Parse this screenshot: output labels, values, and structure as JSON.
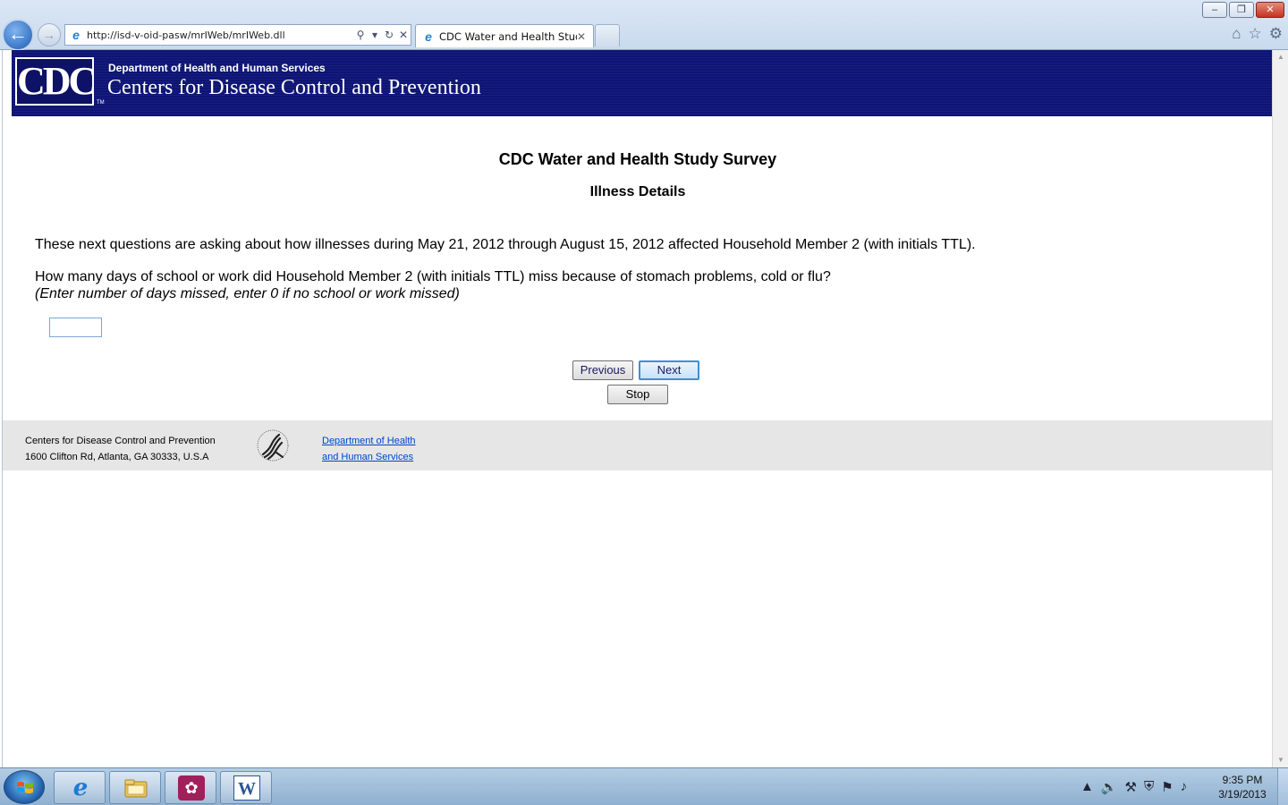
{
  "browser": {
    "address_url": "http://isd-v-oid-pasw/mrIWeb/mrIWeb.dll",
    "tab_title": "CDC Water and Health Study",
    "window_controls": {
      "minimize": "–",
      "restore": "❐",
      "close": "✕"
    },
    "icons": [
      "back-arrow-icon",
      "forward-arrow-icon",
      "search-icon",
      "refresh-icon",
      "stop-icon",
      "home-icon",
      "favorites-star-icon",
      "settings-gear-icon"
    ]
  },
  "banner": {
    "logo_text": "CDC",
    "department": "Department of Health and Human Services",
    "agency": "Centers for Disease Control and Prevention"
  },
  "survey": {
    "title": "CDC Water and Health Study Survey",
    "section": "Illness Details",
    "intro": "These next questions are asking about how illnesses during May 21, 2012 through August 15, 2012 affected Household Member 2 (with initials TTL).",
    "question": "How many days of school or work did Household Member 2 (with initials TTL) miss because of stomach problems, cold or flu?",
    "instruction": "(Enter number of days missed, enter 0 if no school or work missed)",
    "days_missed_value": "",
    "buttons": {
      "previous": "Previous",
      "next": "Next",
      "stop": "Stop"
    }
  },
  "footer": {
    "org_line1": "Centers for Disease Control and Prevention",
    "org_line2": "1600 Clifton Rd, Atlanta, GA 30333, U.S.A",
    "hhs_link_line1": "Department of Health",
    "hhs_link_line2": "and Human Services"
  },
  "taskbar": {
    "apps": [
      "internet-explorer-icon",
      "file-explorer-icon",
      "app-icon",
      "word-icon"
    ],
    "clock_time": "9:35 PM",
    "clock_date": "3/19/2013"
  },
  "colors": {
    "banner_blue": "#0f1570",
    "footer_gray": "#e6e6e6",
    "link_blue": "#0044cc",
    "next_focus_border": "#3c8fd8"
  }
}
